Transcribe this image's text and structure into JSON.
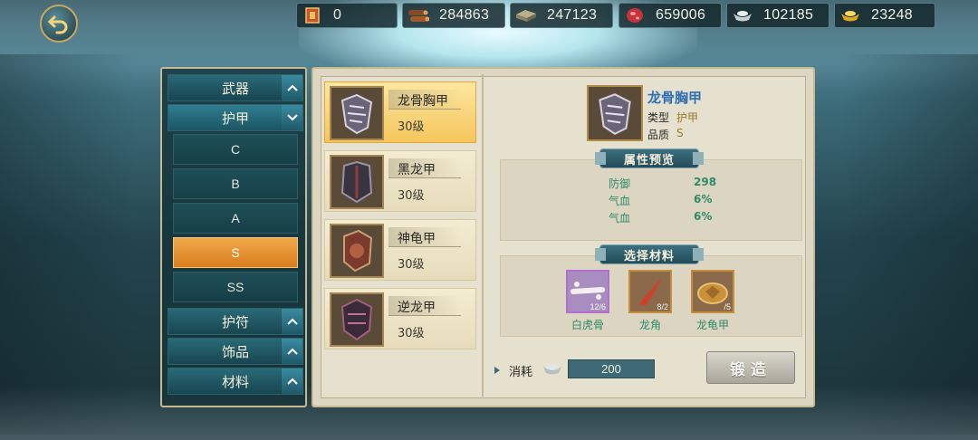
{
  "currencies": [
    {
      "icon": "token-icon",
      "value": "0"
    },
    {
      "icon": "wood-icon",
      "value": "284863"
    },
    {
      "icon": "stone-icon",
      "value": "247123"
    },
    {
      "icon": "meat-icon",
      "value": "659006"
    },
    {
      "icon": "silver-ingot-icon",
      "value": "102185"
    },
    {
      "icon": "gold-ingot-icon",
      "value": "23248"
    }
  ],
  "categories": {
    "weapon": "武器",
    "armor": "护甲",
    "amulet": "护符",
    "ornament": "饰品",
    "material": "材料"
  },
  "grades": [
    "C",
    "B",
    "A",
    "S",
    "SS"
  ],
  "selected_grade": "S",
  "items": [
    {
      "name": "龙骨胸甲",
      "level": "30级"
    },
    {
      "name": "黑龙甲",
      "level": "30级"
    },
    {
      "name": "神龟甲",
      "level": "30级"
    },
    {
      "name": "逆龙甲",
      "level": "30级"
    }
  ],
  "detail": {
    "name": "龙骨胸甲",
    "type_key": "类型",
    "type_val": "护甲",
    "quality_key": "品质",
    "quality_val": "S"
  },
  "attr_header": "属性预览",
  "attributes": [
    {
      "name": "防御",
      "value": "298"
    },
    {
      "name": "气血",
      "value": "6%"
    },
    {
      "name": "气血",
      "value": "6%"
    }
  ],
  "material_header": "选择材料",
  "materials": [
    {
      "name": "白虎骨",
      "count": "12/6"
    },
    {
      "name": "龙角",
      "count": "8/2"
    },
    {
      "name": "龙龟甲",
      "count": "/5"
    }
  ],
  "cost": {
    "label": "消耗",
    "value": "200"
  },
  "forge_label": "锻造",
  "colors": {
    "accent_orange": "#f0a84a",
    "title_blue": "#2f6fb4",
    "attr_green": "#2e8a66"
  }
}
